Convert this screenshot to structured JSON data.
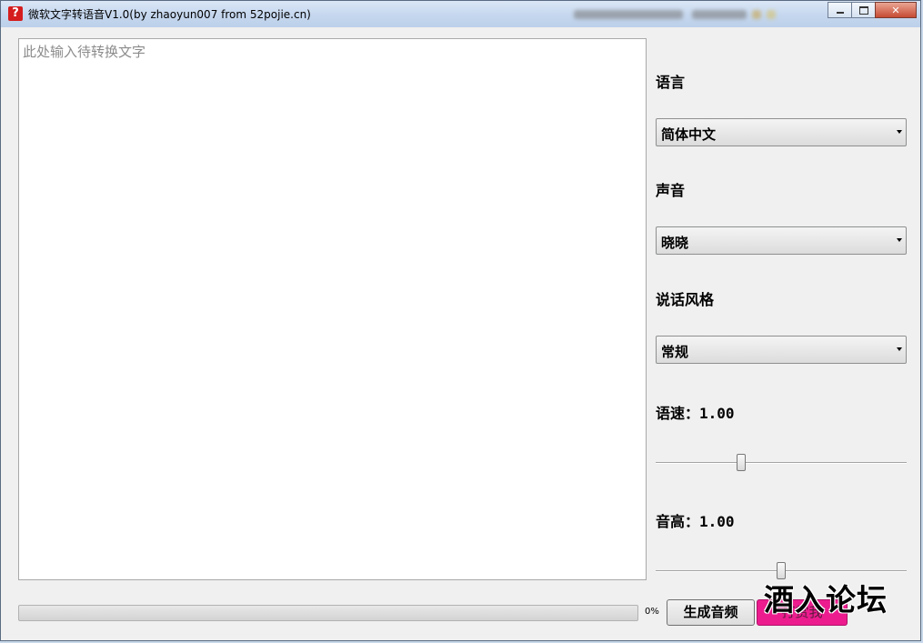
{
  "window": {
    "title": "微软文字转语音V1.0(by zhaoyun007 from 52pojie.cn)",
    "icon": "question-mark-icon",
    "controls": {
      "minimize": "minimize-icon",
      "maximize": "maximize-icon",
      "close": "close-icon"
    }
  },
  "editor": {
    "placeholder": "此处输入待转换文字",
    "value": ""
  },
  "settings": {
    "language_label": "语言",
    "language_value": "简体中文",
    "voice_label": "声音",
    "voice_value": "晓晓",
    "style_label": "说话风格",
    "style_value": "常规",
    "speed_label": "语速：1.00",
    "speed_slider_level": 0.34,
    "pitch_label": "音高：1.00",
    "pitch_slider_level": 0.5
  },
  "progress": {
    "value": 0,
    "text": "0%"
  },
  "buttons": {
    "generate": "生成音频",
    "reward": "打赏我"
  },
  "watermark": {
    "text": "酒入论坛"
  },
  "colors": {
    "reward_button": "#ec1c8e",
    "progress_fill": "#38b449",
    "close_button": "#c74b34"
  }
}
